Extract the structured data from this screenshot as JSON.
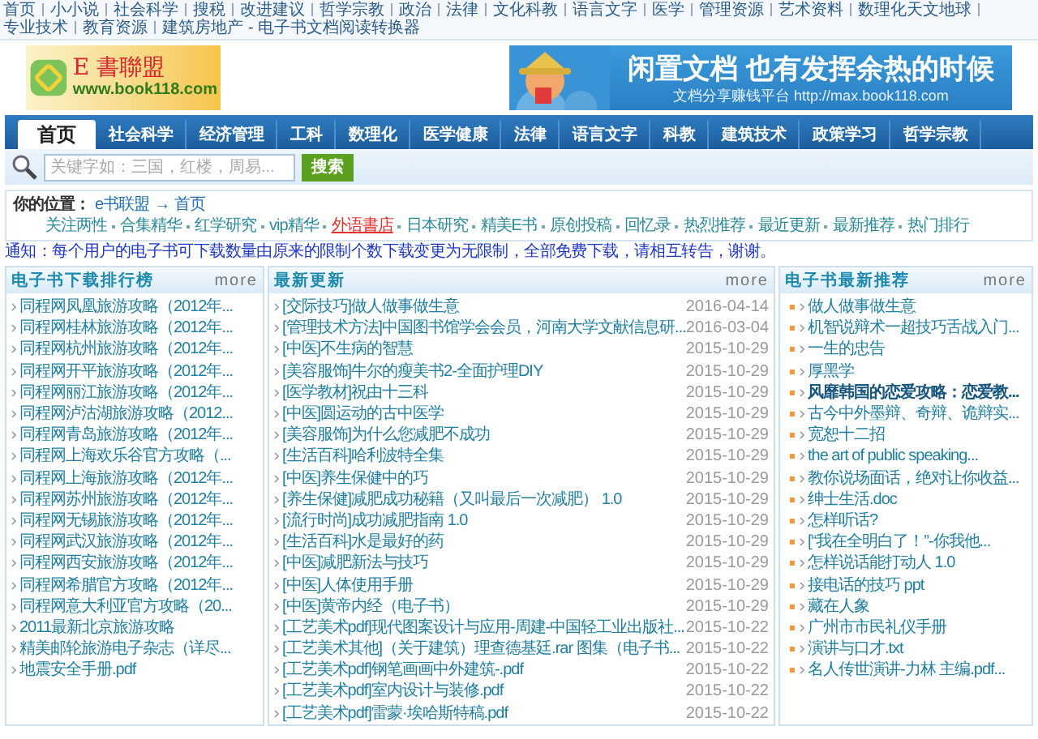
{
  "top_links": [
    "首页",
    "小小说",
    "社会科学",
    "搜税",
    "改进建议",
    "哲学宗教",
    "政治",
    "法律",
    "文化科教",
    "语言文字",
    "医学",
    "管理资源",
    "艺术资料",
    "数理化天文地球",
    "专业技术",
    "教育资源",
    "建筑房地产"
  ],
  "top_suffix": "- 电子书文档阅读转换器",
  "logo": {
    "mark": "E 書聯盟",
    "url": "www.book118.com"
  },
  "banner": {
    "headline": "闲置文档 也有发挥余热的时候",
    "subline": "文档分享赚钱平台 http://max.book118.com"
  },
  "nav_tabs": [
    {
      "label": "首页",
      "selected": true
    },
    {
      "label": "社会科学",
      "selected": false
    },
    {
      "label": "经济管理",
      "selected": false
    },
    {
      "label": "工科",
      "selected": false
    },
    {
      "label": "数理化",
      "selected": false
    },
    {
      "label": "医学健康",
      "selected": false
    },
    {
      "label": "法律",
      "selected": false
    },
    {
      "label": "语言文字",
      "selected": false
    },
    {
      "label": "科教",
      "selected": false
    },
    {
      "label": "建筑技术",
      "selected": false
    },
    {
      "label": "政策学习",
      "selected": false
    },
    {
      "label": "哲学宗教",
      "selected": false
    }
  ],
  "search": {
    "placeholder": "关键字如：三国，红楼，周易...",
    "button": "搜索"
  },
  "breadcrumb": {
    "label": "你的位置：",
    "links": [
      "e书联盟",
      "→",
      "首页"
    ]
  },
  "quick_links": [
    {
      "label": "关注两性",
      "highlighted": false
    },
    {
      "label": "合集精华",
      "highlighted": false
    },
    {
      "label": "红学研究",
      "highlighted": false
    },
    {
      "label": "vip精华",
      "highlighted": false
    },
    {
      "label": "外语書店",
      "highlighted": true
    },
    {
      "label": "日本研究",
      "highlighted": false
    },
    {
      "label": "精美E书",
      "highlighted": false
    },
    {
      "label": "原创投稿",
      "highlighted": false
    },
    {
      "label": "回忆录",
      "highlighted": false
    },
    {
      "label": "热烈推荐",
      "highlighted": false
    },
    {
      "label": "最近更新",
      "highlighted": false
    },
    {
      "label": "最新推荐",
      "highlighted": false
    },
    {
      "label": "热门排行",
      "highlighted": false
    }
  ],
  "notice": "通知：每个用户的电子书可下载数量由原来的限制个数下载变更为无限制，全部免费下载，请相互转告，谢谢。",
  "panels": [
    {
      "kind": "ranking",
      "title": "电子书下载排行榜",
      "more": "more",
      "items": [
        {
          "title": "同程网凤凰旅游攻略（2012年..."
        },
        {
          "title": "同程网桂林旅游攻略（2012年..."
        },
        {
          "title": "同程网杭州旅游攻略（2012年..."
        },
        {
          "title": "同程网开平旅游攻略（2012年..."
        },
        {
          "title": "同程网丽江旅游攻略（2012年..."
        },
        {
          "title": "同程网泸沽湖旅游攻略（2012..."
        },
        {
          "title": "同程网青岛旅游攻略（2012年..."
        },
        {
          "title": "同程网上海欢乐谷官方攻略（..."
        },
        {
          "title": "同程网上海旅游攻略（2012年..."
        },
        {
          "title": "同程网苏州旅游攻略（2012年..."
        },
        {
          "title": "同程网无锡旅游攻略（2012年..."
        },
        {
          "title": "同程网武汉旅游攻略（2012年..."
        },
        {
          "title": "同程网西安旅游攻略（2012年..."
        },
        {
          "title": "同程网希腊官方攻略（2012年..."
        },
        {
          "title": "同程网意大利亚官方攻略（20..."
        },
        {
          "title": "2011最新北京旅游攻略"
        },
        {
          "title": "精美邮轮旅游电子杂志（详尽..."
        },
        {
          "title": "地震安全手册.pdf"
        }
      ]
    },
    {
      "kind": "updates",
      "title": "最新更新",
      "more": "more",
      "items": [
        {
          "title": "[交际技巧]做人做事做生意",
          "date": "2016-04-14"
        },
        {
          "title": "[管理技术方法]中国图书馆学会会员，河南大学文献信息研...",
          "date": "2016-03-04"
        },
        {
          "title": "[中医]不生病的智慧",
          "date": "2015-10-29"
        },
        {
          "title": "[美容服饰]牛尔的瘦美书2-全面护理DIY",
          "date": "2015-10-29"
        },
        {
          "title": "[医学教材]祝由十三科",
          "date": "2015-10-29"
        },
        {
          "title": "[中医]圆运动的古中医学",
          "date": "2015-10-29"
        },
        {
          "title": "[美容服饰]为什么您减肥不成功",
          "date": "2015-10-29"
        },
        {
          "title": "[生活百科]哈利波特全集",
          "date": "2015-10-29"
        },
        {
          "title": "[中医]养生保健中的巧",
          "date": "2015-10-29"
        },
        {
          "title": "[养生保健]减肥成功秘籍（又叫最后一次减肥） 1.0",
          "date": "2015-10-29"
        },
        {
          "title": "[流行时尚]成功减肥指南 1.0",
          "date": "2015-10-29"
        },
        {
          "title": "[生活百科]水是最好的药",
          "date": "2015-10-29"
        },
        {
          "title": "[中医]减肥新法与技巧",
          "date": "2015-10-29"
        },
        {
          "title": "[中医]人体使用手册",
          "date": "2015-10-29"
        },
        {
          "title": "[中医]黄帝内经（电子书）",
          "date": "2015-10-29"
        },
        {
          "title": "[工艺美术pdf]现代图案设计与应用-周建-中国轻工业出版社...",
          "date": "2015-10-22"
        },
        {
          "title": "[工艺美术其他]（关于建筑）理查德基廷.rar 图集（电子书...",
          "date": "2015-10-22"
        },
        {
          "title": "[工艺美术pdf]钢笔画画中外建筑-.pdf",
          "date": "2015-10-22"
        },
        {
          "title": "[工艺美术pdf]室内设计与装修.pdf",
          "date": "2015-10-22"
        },
        {
          "title": "[工艺美术pdf]雷蒙·埃哈斯特稿.pdf",
          "date": "2015-10-22"
        }
      ]
    },
    {
      "kind": "recommend",
      "title": "电子书最新推荐",
      "more": "more",
      "items": [
        {
          "title": "做人做事做生意",
          "bold": false
        },
        {
          "title": "机智说辩术一超技巧舌战入门...",
          "bold": false
        },
        {
          "title": "一生的忠告",
          "bold": false
        },
        {
          "title": "厚黑学",
          "bold": false
        },
        {
          "title": "风靡韩国的恋爱攻略：恋爱教...",
          "bold": true
        },
        {
          "title": "古今中外墨辩、奇辩、诡辩实...",
          "bold": false
        },
        {
          "title": "宽恕十二招",
          "bold": false
        },
        {
          "title": "the art of public speaking...",
          "bold": false
        },
        {
          "title": "教你说场面话，绝对让你收益...",
          "bold": false
        },
        {
          "title": "绅士生活.doc",
          "bold": false
        },
        {
          "title": "怎样听话?",
          "bold": false
        },
        {
          "title": "[“我在全明白了！”-你我他...",
          "bold": false
        },
        {
          "title": "怎样说话能打动人 1.0",
          "bold": false
        },
        {
          "title": "接电话的技巧 ppt",
          "bold": false
        },
        {
          "title": "藏在人象",
          "bold": false
        },
        {
          "title": "广州市市民礼仪手册",
          "bold": false
        },
        {
          "title": "演讲与口才.txt",
          "bold": false
        },
        {
          "title": "名人传世演讲-力林 主编.pdf...",
          "bold": false
        }
      ]
    }
  ]
}
